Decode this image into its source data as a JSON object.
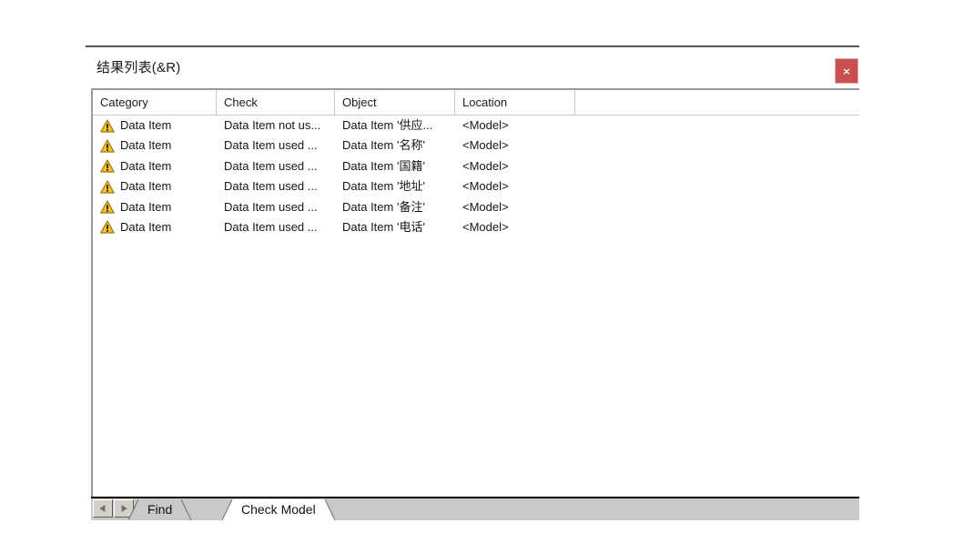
{
  "window": {
    "title": "结果列表(&R)",
    "close_label": "×",
    "close_icon": "close-icon",
    "accent_close_color": "#c8504f"
  },
  "list": {
    "columns": [
      {
        "key": "category",
        "label": "Category"
      },
      {
        "key": "check",
        "label": "Check"
      },
      {
        "key": "object",
        "label": "Object"
      },
      {
        "key": "location",
        "label": "Location"
      }
    ],
    "rows": [
      {
        "icon": "warning-icon",
        "category": "Data Item",
        "check": "Data Item not us...",
        "object": "Data Item '供应...",
        "location": "<Model>"
      },
      {
        "icon": "warning-icon",
        "category": "Data Item",
        "check": "Data Item used ...",
        "object": "Data Item '名称'",
        "location": "<Model>"
      },
      {
        "icon": "warning-icon",
        "category": "Data Item",
        "check": "Data Item used ...",
        "object": "Data Item '国籍'",
        "location": "<Model>"
      },
      {
        "icon": "warning-icon",
        "category": "Data Item",
        "check": "Data Item used ...",
        "object": "Data Item '地址'",
        "location": "<Model>"
      },
      {
        "icon": "warning-icon",
        "category": "Data Item",
        "check": "Data Item used ...",
        "object": "Data Item '备注'",
        "location": "<Model>"
      },
      {
        "icon": "warning-icon",
        "category": "Data Item",
        "check": "Data Item used ...",
        "object": "Data Item '电话'",
        "location": "<Model>"
      }
    ]
  },
  "tabstrip": {
    "scroll_prev_icon": "triangle-left-icon",
    "scroll_next_icon": "triangle-right-icon",
    "tabs": [
      {
        "label": "Find",
        "active": false
      },
      {
        "label": "Check Model",
        "active": true
      }
    ]
  },
  "colors": {
    "warning_fill": "#f2c230",
    "warning_edge": "#9a7510",
    "tabstrip_bg": "#c9c9c9",
    "panel_rule": "#55555a"
  }
}
